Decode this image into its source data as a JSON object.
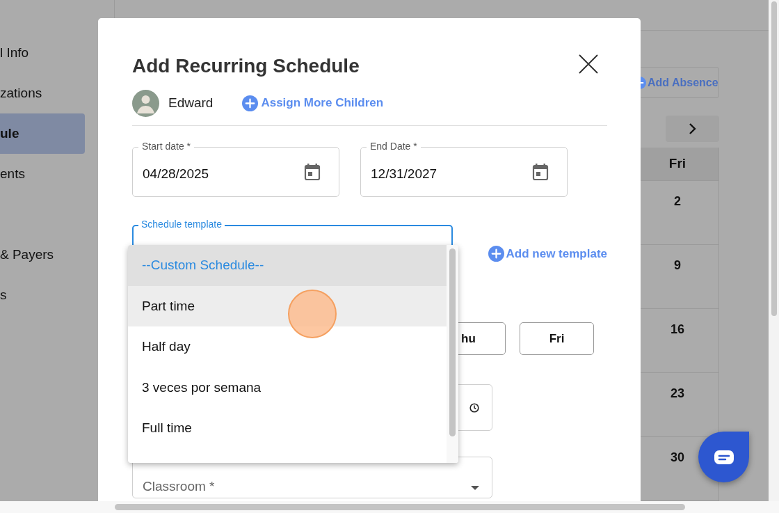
{
  "sidebar": {
    "items": [
      {
        "label": "l Info",
        "selected": false
      },
      {
        "label": "zations",
        "selected": false
      },
      {
        "label": "ule",
        "selected": true
      },
      {
        "label": "ents",
        "selected": false
      },
      {
        "label": "& Payers",
        "selected": false
      },
      {
        "label": "s",
        "selected": false
      }
    ]
  },
  "background": {
    "add_absence_button": "Add Absence",
    "calendar": {
      "column": "Fri",
      "days": [
        "2",
        "9",
        "16",
        "23",
        "30"
      ]
    }
  },
  "dialog": {
    "title": "Add Recurring Schedule",
    "child": {
      "name": "Edward"
    },
    "assign_link": "Assign More Children",
    "start_date": {
      "label": "Start date *",
      "value": "04/28/2025"
    },
    "end_date": {
      "label": "End Date *",
      "value": "12/31/2027"
    },
    "schedule_template": {
      "label": "Schedule template",
      "expanded": true,
      "options": [
        {
          "label": "--Custom Schedule--",
          "selected": true,
          "hovered": false
        },
        {
          "label": "Part time",
          "selected": false,
          "hovered": true
        },
        {
          "label": "Half day",
          "selected": false,
          "hovered": false
        },
        {
          "label": "3 veces por semana",
          "selected": false,
          "hovered": false
        },
        {
          "label": "Full time",
          "selected": false,
          "hovered": false
        }
      ]
    },
    "add_template_link": "Add new template",
    "days": [
      "hu",
      "Fri"
    ],
    "classroom": {
      "placeholder": "Classroom *"
    }
  }
}
